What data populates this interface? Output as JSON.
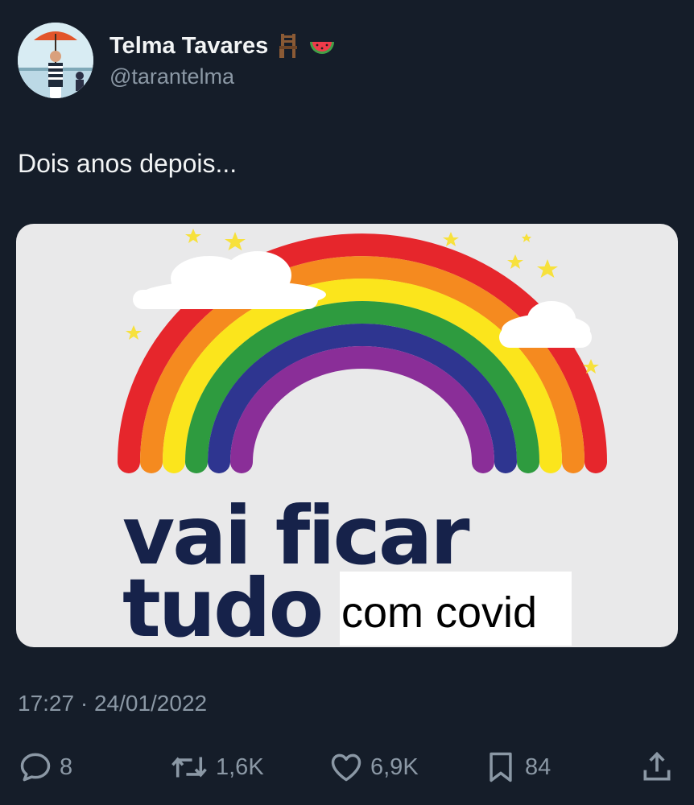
{
  "author": {
    "name": "Telma Tavares",
    "handle": "@tarantelma",
    "name_emojis": [
      "chair-icon",
      "watermelon-icon"
    ]
  },
  "tweet": {
    "text": "Dois anos depois...",
    "timestamp": "17:27 · 24/01/2022"
  },
  "media": {
    "line1": "vai ficar",
    "line2": "tudo",
    "overlay": "com covid",
    "colors": {
      "background": "#e9e9ea",
      "text": "#16224a",
      "rainbow": [
        "#e6262c",
        "#f58a1f",
        "#fbe51c",
        "#2e9b3f",
        "#2e3590",
        "#8a2e98"
      ],
      "stars": "#f7e13c"
    }
  },
  "actions": {
    "replies": "8",
    "retweets": "1,6K",
    "likes": "6,9K",
    "bookmarks": "84"
  },
  "theme": {
    "background": "#151d29",
    "text": "#e7e9ea",
    "secondary": "#8b98a5"
  }
}
